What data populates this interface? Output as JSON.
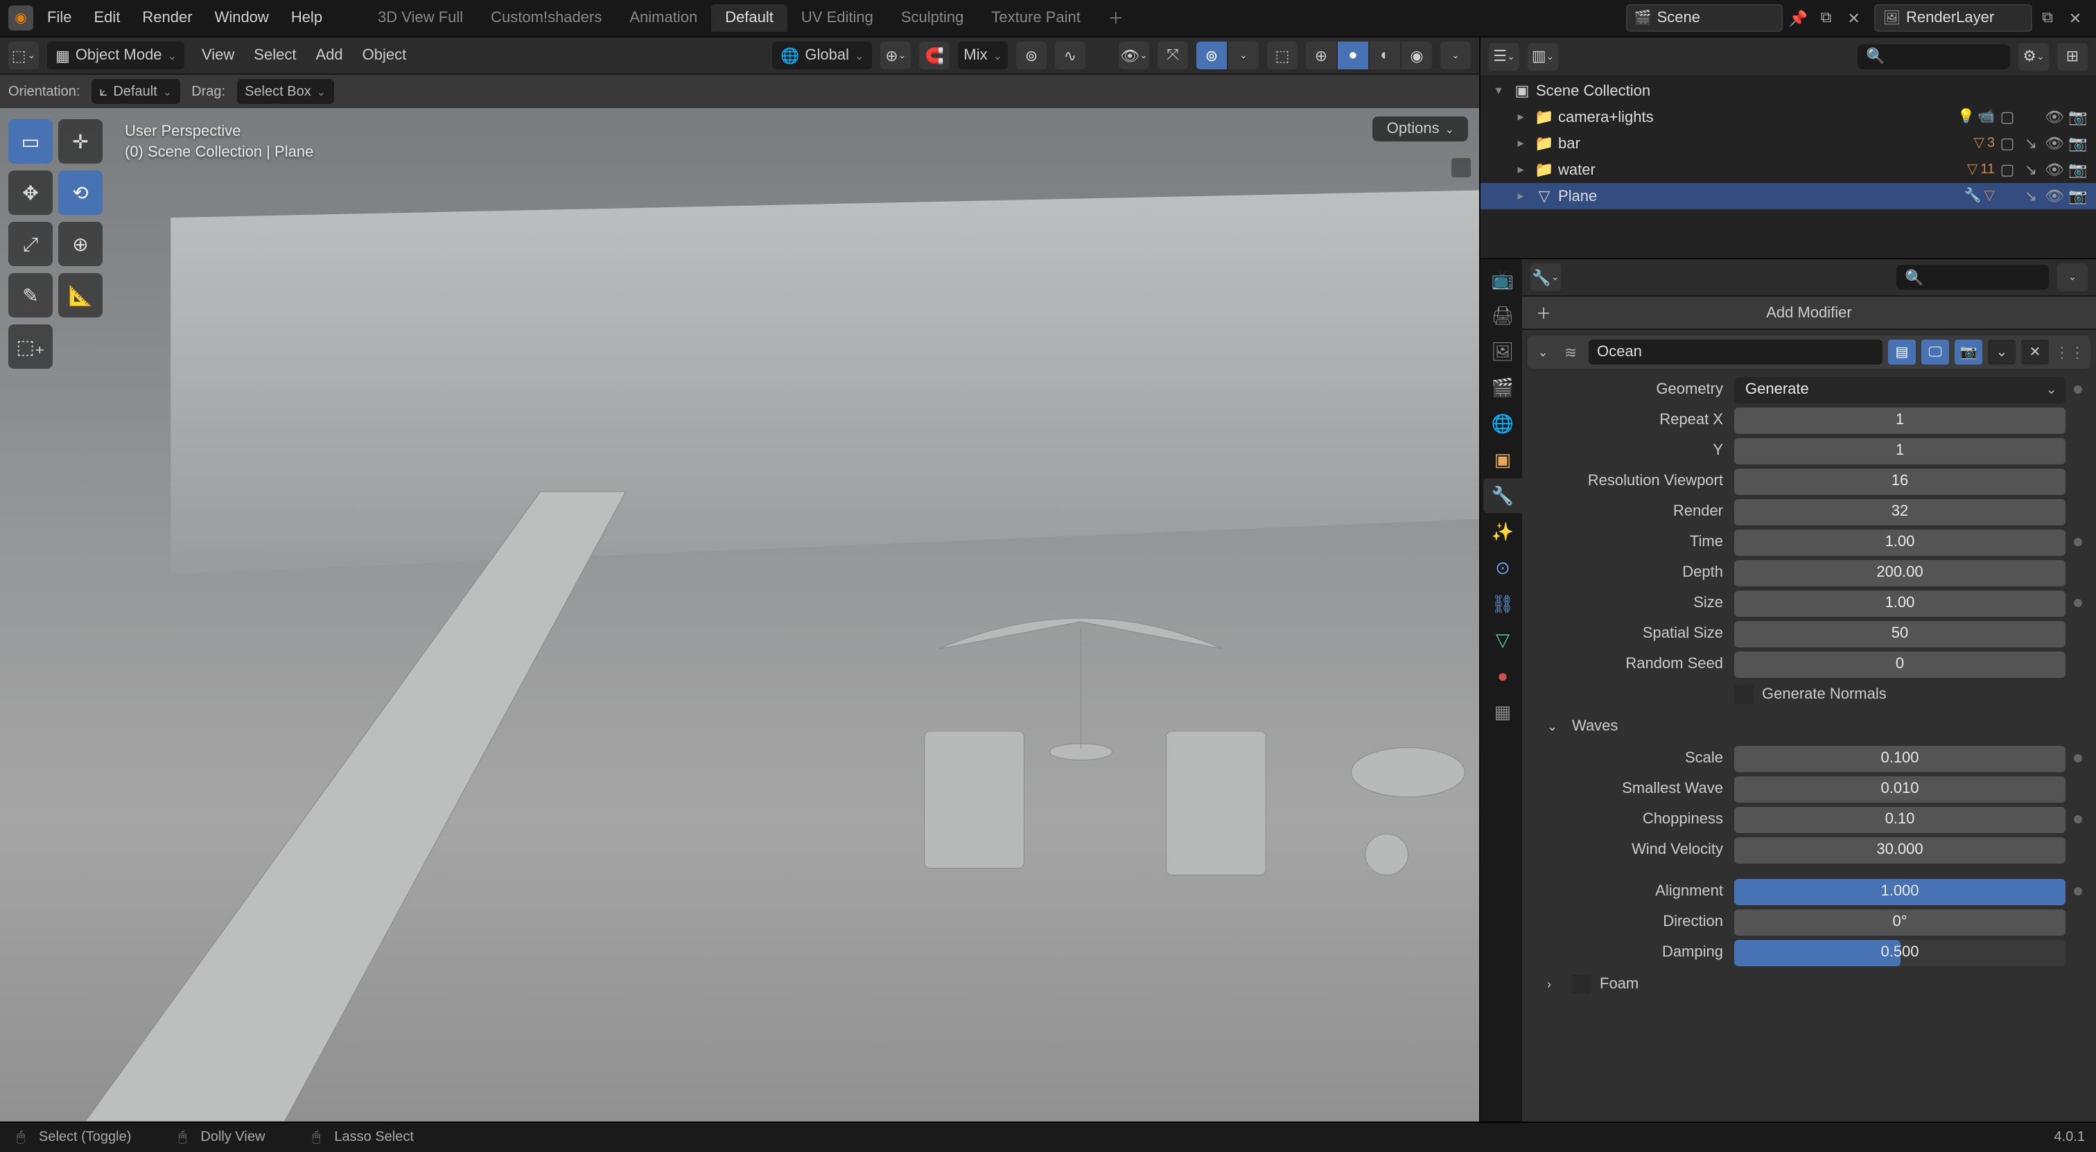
{
  "topMenu": [
    "File",
    "Edit",
    "Render",
    "Window",
    "Help"
  ],
  "workspaces": [
    "3D View Full",
    "Custom!shaders",
    "Animation",
    "Default",
    "UV Editing",
    "Sculpting",
    "Texture Paint"
  ],
  "activeWorkspace": 3,
  "sceneField": "Scene",
  "renderLayerField": "RenderLayer",
  "viewport": {
    "mode": "Object Mode",
    "menus": [
      "View",
      "Select",
      "Add",
      "Object"
    ],
    "orientation": "Global",
    "mixLabel": "Mix",
    "orientRow": {
      "orientLabel": "Orientation:",
      "orientValue": "Default",
      "dragLabel": "Drag:",
      "dragValue": "Select Box"
    },
    "overlay1": "User Perspective",
    "overlay2": "(0) Scene Collection | Plane",
    "optionsLabel": "Options"
  },
  "outliner": {
    "root": "Scene Collection",
    "items": [
      {
        "name": "camera+lights",
        "icon": "📁",
        "depth": 1,
        "expandable": true,
        "extras": [
          "💡",
          "📹"
        ],
        "right": [
          "▢",
          "",
          "👁",
          "📷"
        ]
      },
      {
        "name": "bar",
        "icon": "📁",
        "depth": 1,
        "expandable": true,
        "extras": [
          "▽",
          "3"
        ],
        "right": [
          "▢",
          "↘",
          "👁",
          "📷"
        ]
      },
      {
        "name": "water",
        "icon": "📁",
        "depth": 1,
        "expandable": true,
        "extras": [
          "▽",
          "11"
        ],
        "right": [
          "▢",
          "↘",
          "👁",
          "📷"
        ]
      },
      {
        "name": "Plane",
        "icon": "▽",
        "depth": 1,
        "expandable": true,
        "selected": true,
        "extras": [
          "🔧",
          "▽"
        ],
        "right": [
          "",
          "↘",
          "👁",
          "📷"
        ]
      }
    ]
  },
  "properties": {
    "addModifier": "Add Modifier",
    "modifierName": "Ocean",
    "geometry": {
      "label": "Geometry",
      "value": "Generate"
    },
    "repeatX": {
      "label": "Repeat X",
      "value": "1"
    },
    "repeatY": {
      "label": "Y",
      "value": "1"
    },
    "resViewport": {
      "label": "Resolution Viewport",
      "value": "16"
    },
    "resRender": {
      "label": "Render",
      "value": "32"
    },
    "time": {
      "label": "Time",
      "value": "1.00"
    },
    "depth": {
      "label": "Depth",
      "value": "200.00"
    },
    "size": {
      "label": "Size",
      "value": "1.00"
    },
    "spatialSize": {
      "label": "Spatial Size",
      "value": "50"
    },
    "randomSeed": {
      "label": "Random Seed",
      "value": "0"
    },
    "genNormals": "Generate Normals",
    "wavesHeader": "Waves",
    "scale": {
      "label": "Scale",
      "value": "0.100"
    },
    "smallestWave": {
      "label": "Smallest Wave",
      "value": "0.010"
    },
    "choppiness": {
      "label": "Choppiness",
      "value": "0.10"
    },
    "windVelocity": {
      "label": "Wind Velocity",
      "value": "30.000"
    },
    "alignment": {
      "label": "Alignment",
      "value": "1.000",
      "fill": 1.0
    },
    "direction": {
      "label": "Direction",
      "value": "0°"
    },
    "damping": {
      "label": "Damping",
      "value": "0.500",
      "fill": 0.5
    },
    "foamHeader": "Foam"
  },
  "statusbar": {
    "items": [
      "Select (Toggle)",
      "Dolly View",
      "Lasso Select"
    ],
    "version": "4.0.1"
  }
}
